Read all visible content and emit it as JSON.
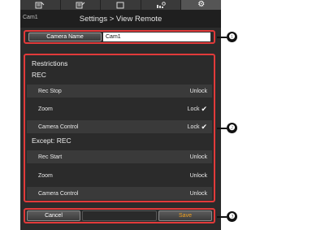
{
  "tabs": [
    {
      "icon": "document-icon",
      "active": false
    },
    {
      "icon": "document-icon",
      "active": false
    },
    {
      "icon": "screen-icon",
      "active": false
    },
    {
      "icon": "camera-settings-icon",
      "active": false
    },
    {
      "icon": "gear-icon",
      "active": true
    }
  ],
  "header": {
    "back_label": "Cam1",
    "title": "Settings > View Remote"
  },
  "camera_name": {
    "label": "Camera Name",
    "value": "Cam1"
  },
  "restrictions": {
    "title": "Restrictions",
    "rec": {
      "heading": "REC",
      "rows": [
        {
          "label": "Rec Stop",
          "status": "Unlock",
          "checked": false
        },
        {
          "label": "Zoom",
          "status": "Lock",
          "checked": true
        },
        {
          "label": "Camera Control",
          "status": "Lock",
          "checked": true
        }
      ]
    },
    "except": {
      "heading": "Except: REC",
      "rows": [
        {
          "label": "Rec Start",
          "status": "Unlock",
          "checked": false
        },
        {
          "label": "Zoom",
          "status": "Unlock",
          "checked": false
        },
        {
          "label": "Camera Control",
          "status": "Unlock",
          "checked": false
        }
      ]
    }
  },
  "footer": {
    "cancel_label": "Cancel",
    "save_label": "Save"
  },
  "callouts": [
    "❶",
    "❷",
    "❸"
  ],
  "colors": {
    "highlight": "#e23a3a",
    "save_text": "#f0a020",
    "background": "#2b2b2b"
  }
}
